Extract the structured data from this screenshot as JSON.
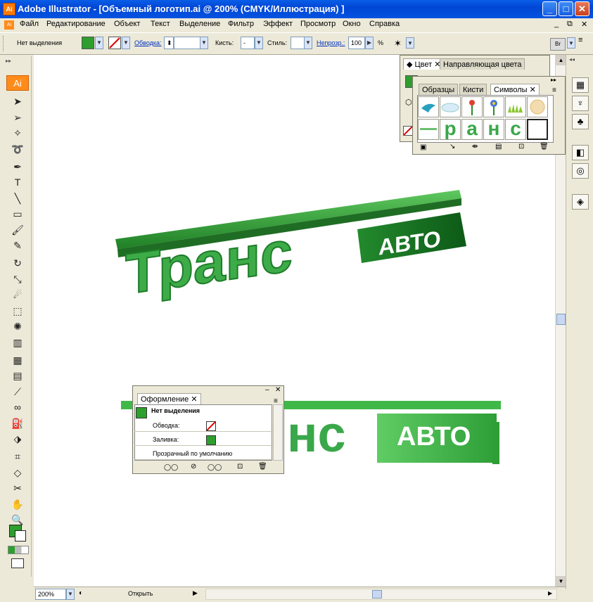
{
  "window": {
    "title": "Adobe Illustrator - [Объемный логотип.ai @ 200% (CMYK/Иллюстрация) ]",
    "app_icon_text": "Ai",
    "buttons": [
      "_",
      "□",
      "✕"
    ]
  },
  "menubar": {
    "items": [
      "Файл",
      "Редактирование",
      "Объект",
      "Текст",
      "Выделение",
      "Фильтр",
      "Эффект",
      "Просмотр",
      "Окно",
      "Справка"
    ],
    "doc_buttons": [
      "_",
      "⧉",
      "✕"
    ]
  },
  "control_bar": {
    "selection_label": "Нет выделения",
    "fill_color": "#2e9e2e",
    "stroke_label": "Обводка:",
    "brush_label": "Кисть:",
    "brush_value": "-",
    "style_label": "Стиль:",
    "opacity_label": "Непрозр.:",
    "opacity_value": "100",
    "opacity_unit": "%"
  },
  "toolbox": {
    "badge": "Ai",
    "tools": [
      "selection-tool",
      "direct-selection-tool",
      "magic-wand-tool",
      "lasso-tool",
      "pen-tool",
      "type-tool",
      "line-tool",
      "rectangle-tool",
      "paintbrush-tool",
      "pencil-tool",
      "rotate-tool",
      "scale-tool",
      "warp-tool",
      "free-transform-tool",
      "symbol-sprayer-tool",
      "column-graph-tool",
      "mesh-tool",
      "gradient-tool",
      "eyedropper-tool",
      "blend-tool",
      "live-paint-bucket-tool",
      "live-paint-selection-tool",
      "crop-area-tool",
      "eraser-tool",
      "scissors-tool",
      "hand-tool",
      "zoom-tool"
    ]
  },
  "panels": {
    "color": {
      "tabs": [
        "Цвет",
        "Направляющая цвета"
      ],
      "fill_color": "#2e9e2e"
    },
    "symbols": {
      "tabs": [
        "Образцы",
        "Кисти",
        "Символы"
      ],
      "logo_symbols": [
        "р",
        "а",
        "н",
        "с"
      ]
    },
    "appearance": {
      "tab": "Оформление",
      "header": "Нет выделения",
      "rows": [
        {
          "label": "Обводка:"
        },
        {
          "label": "Заливка:"
        },
        {
          "label": "Прозрачный по умолчанию"
        }
      ]
    }
  },
  "artwork": {
    "logo_top_word": "Транс",
    "logo_top_badge": "АВТО",
    "logo_bottom_word": "нс",
    "logo_bottom_badge": "АВТО",
    "green": "#2e9e2e"
  },
  "statusbar": {
    "zoom": "200%",
    "status_text": "Открыть"
  }
}
